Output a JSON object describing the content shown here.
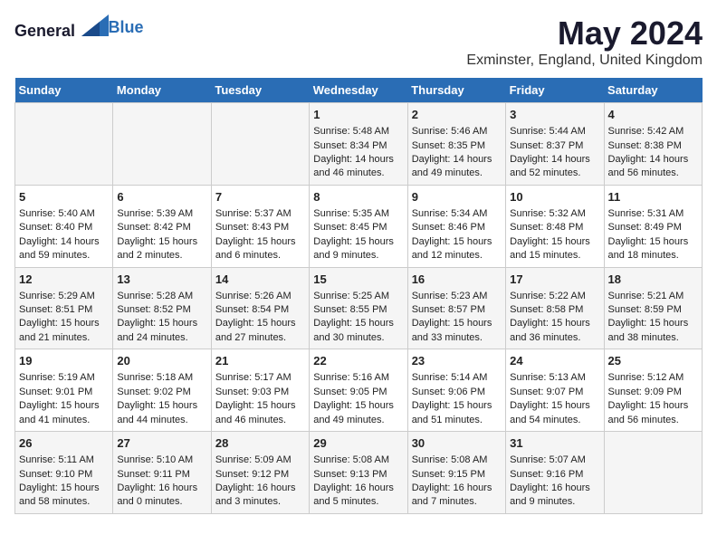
{
  "header": {
    "logo_general": "General",
    "logo_blue": "Blue",
    "month_title": "May 2024",
    "location": "Exminster, England, United Kingdom"
  },
  "weekdays": [
    "Sunday",
    "Monday",
    "Tuesday",
    "Wednesday",
    "Thursday",
    "Friday",
    "Saturday"
  ],
  "weeks": [
    [
      {
        "day": "",
        "sunrise": "",
        "sunset": "",
        "daylight": ""
      },
      {
        "day": "",
        "sunrise": "",
        "sunset": "",
        "daylight": ""
      },
      {
        "day": "",
        "sunrise": "",
        "sunset": "",
        "daylight": ""
      },
      {
        "day": "1",
        "sunrise": "Sunrise: 5:48 AM",
        "sunset": "Sunset: 8:34 PM",
        "daylight": "Daylight: 14 hours and 46 minutes."
      },
      {
        "day": "2",
        "sunrise": "Sunrise: 5:46 AM",
        "sunset": "Sunset: 8:35 PM",
        "daylight": "Daylight: 14 hours and 49 minutes."
      },
      {
        "day": "3",
        "sunrise": "Sunrise: 5:44 AM",
        "sunset": "Sunset: 8:37 PM",
        "daylight": "Daylight: 14 hours and 52 minutes."
      },
      {
        "day": "4",
        "sunrise": "Sunrise: 5:42 AM",
        "sunset": "Sunset: 8:38 PM",
        "daylight": "Daylight: 14 hours and 56 minutes."
      }
    ],
    [
      {
        "day": "5",
        "sunrise": "Sunrise: 5:40 AM",
        "sunset": "Sunset: 8:40 PM",
        "daylight": "Daylight: 14 hours and 59 minutes."
      },
      {
        "day": "6",
        "sunrise": "Sunrise: 5:39 AM",
        "sunset": "Sunset: 8:42 PM",
        "daylight": "Daylight: 15 hours and 2 minutes."
      },
      {
        "day": "7",
        "sunrise": "Sunrise: 5:37 AM",
        "sunset": "Sunset: 8:43 PM",
        "daylight": "Daylight: 15 hours and 6 minutes."
      },
      {
        "day": "8",
        "sunrise": "Sunrise: 5:35 AM",
        "sunset": "Sunset: 8:45 PM",
        "daylight": "Daylight: 15 hours and 9 minutes."
      },
      {
        "day": "9",
        "sunrise": "Sunrise: 5:34 AM",
        "sunset": "Sunset: 8:46 PM",
        "daylight": "Daylight: 15 hours and 12 minutes."
      },
      {
        "day": "10",
        "sunrise": "Sunrise: 5:32 AM",
        "sunset": "Sunset: 8:48 PM",
        "daylight": "Daylight: 15 hours and 15 minutes."
      },
      {
        "day": "11",
        "sunrise": "Sunrise: 5:31 AM",
        "sunset": "Sunset: 8:49 PM",
        "daylight": "Daylight: 15 hours and 18 minutes."
      }
    ],
    [
      {
        "day": "12",
        "sunrise": "Sunrise: 5:29 AM",
        "sunset": "Sunset: 8:51 PM",
        "daylight": "Daylight: 15 hours and 21 minutes."
      },
      {
        "day": "13",
        "sunrise": "Sunrise: 5:28 AM",
        "sunset": "Sunset: 8:52 PM",
        "daylight": "Daylight: 15 hours and 24 minutes."
      },
      {
        "day": "14",
        "sunrise": "Sunrise: 5:26 AM",
        "sunset": "Sunset: 8:54 PM",
        "daylight": "Daylight: 15 hours and 27 minutes."
      },
      {
        "day": "15",
        "sunrise": "Sunrise: 5:25 AM",
        "sunset": "Sunset: 8:55 PM",
        "daylight": "Daylight: 15 hours and 30 minutes."
      },
      {
        "day": "16",
        "sunrise": "Sunrise: 5:23 AM",
        "sunset": "Sunset: 8:57 PM",
        "daylight": "Daylight: 15 hours and 33 minutes."
      },
      {
        "day": "17",
        "sunrise": "Sunrise: 5:22 AM",
        "sunset": "Sunset: 8:58 PM",
        "daylight": "Daylight: 15 hours and 36 minutes."
      },
      {
        "day": "18",
        "sunrise": "Sunrise: 5:21 AM",
        "sunset": "Sunset: 8:59 PM",
        "daylight": "Daylight: 15 hours and 38 minutes."
      }
    ],
    [
      {
        "day": "19",
        "sunrise": "Sunrise: 5:19 AM",
        "sunset": "Sunset: 9:01 PM",
        "daylight": "Daylight: 15 hours and 41 minutes."
      },
      {
        "day": "20",
        "sunrise": "Sunrise: 5:18 AM",
        "sunset": "Sunset: 9:02 PM",
        "daylight": "Daylight: 15 hours and 44 minutes."
      },
      {
        "day": "21",
        "sunrise": "Sunrise: 5:17 AM",
        "sunset": "Sunset: 9:03 PM",
        "daylight": "Daylight: 15 hours and 46 minutes."
      },
      {
        "day": "22",
        "sunrise": "Sunrise: 5:16 AM",
        "sunset": "Sunset: 9:05 PM",
        "daylight": "Daylight: 15 hours and 49 minutes."
      },
      {
        "day": "23",
        "sunrise": "Sunrise: 5:14 AM",
        "sunset": "Sunset: 9:06 PM",
        "daylight": "Daylight: 15 hours and 51 minutes."
      },
      {
        "day": "24",
        "sunrise": "Sunrise: 5:13 AM",
        "sunset": "Sunset: 9:07 PM",
        "daylight": "Daylight: 15 hours and 54 minutes."
      },
      {
        "day": "25",
        "sunrise": "Sunrise: 5:12 AM",
        "sunset": "Sunset: 9:09 PM",
        "daylight": "Daylight: 15 hours and 56 minutes."
      }
    ],
    [
      {
        "day": "26",
        "sunrise": "Sunrise: 5:11 AM",
        "sunset": "Sunset: 9:10 PM",
        "daylight": "Daylight: 15 hours and 58 minutes."
      },
      {
        "day": "27",
        "sunrise": "Sunrise: 5:10 AM",
        "sunset": "Sunset: 9:11 PM",
        "daylight": "Daylight: 16 hours and 0 minutes."
      },
      {
        "day": "28",
        "sunrise": "Sunrise: 5:09 AM",
        "sunset": "Sunset: 9:12 PM",
        "daylight": "Daylight: 16 hours and 3 minutes."
      },
      {
        "day": "29",
        "sunrise": "Sunrise: 5:08 AM",
        "sunset": "Sunset: 9:13 PM",
        "daylight": "Daylight: 16 hours and 5 minutes."
      },
      {
        "day": "30",
        "sunrise": "Sunrise: 5:08 AM",
        "sunset": "Sunset: 9:15 PM",
        "daylight": "Daylight: 16 hours and 7 minutes."
      },
      {
        "day": "31",
        "sunrise": "Sunrise: 5:07 AM",
        "sunset": "Sunset: 9:16 PM",
        "daylight": "Daylight: 16 hours and 9 minutes."
      },
      {
        "day": "",
        "sunrise": "",
        "sunset": "",
        "daylight": ""
      }
    ]
  ]
}
